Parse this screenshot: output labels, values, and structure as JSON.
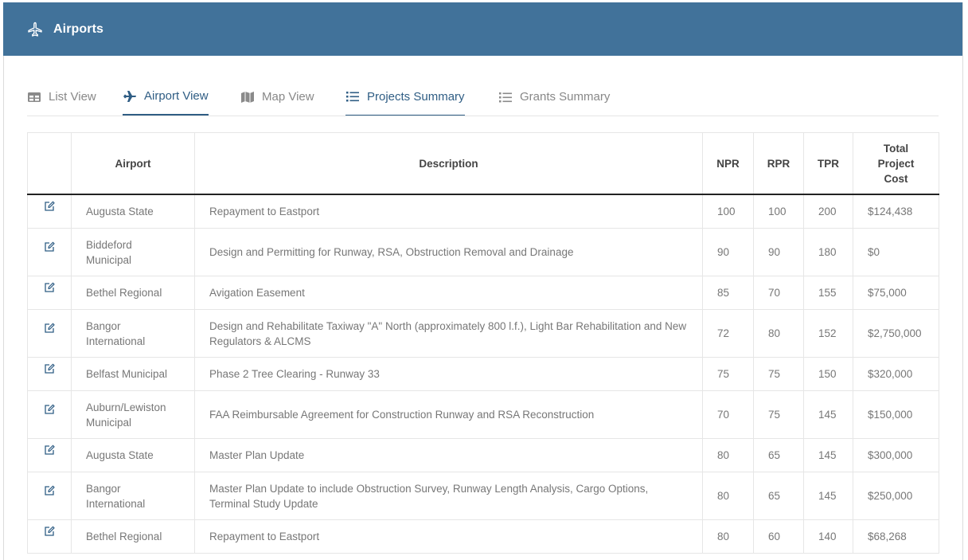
{
  "header": {
    "title": "Airports",
    "icon": "plane-icon"
  },
  "tabs": [
    {
      "label": "List View",
      "icon": "table-icon"
    },
    {
      "label": "Airport View",
      "icon": "plane-icon"
    },
    {
      "label": "Map View",
      "icon": "map-icon"
    },
    {
      "label": "Projects Summary",
      "icon": "list-icon"
    },
    {
      "label": "Grants Summary",
      "icon": "list-icon"
    }
  ],
  "table": {
    "headers": [
      "",
      "Airport",
      "Description",
      "NPR",
      "RPR",
      "TPR",
      "Total Project Cost"
    ],
    "rows": [
      {
        "airport": "Augusta State",
        "description": "Repayment to Eastport",
        "npr": "100",
        "rpr": "100",
        "tpr": "200",
        "cost": "$124,438"
      },
      {
        "airport": "Biddeford Municipal",
        "description": "Design and Permitting for Runway, RSA, Obstruction Removal and Drainage",
        "npr": "90",
        "rpr": "90",
        "tpr": "180",
        "cost": "$0"
      },
      {
        "airport": "Bethel Regional",
        "description": "Avigation Easement",
        "npr": "85",
        "rpr": "70",
        "tpr": "155",
        "cost": "$75,000"
      },
      {
        "airport": "Bangor International",
        "description": "Design and Rehabilitate Taxiway \"A\" North (approximately 800 l.f.), Light Bar Rehabilitation and New Regulators & ALCMS",
        "npr": "72",
        "rpr": "80",
        "tpr": "152",
        "cost": "$2,750,000"
      },
      {
        "airport": "Belfast Municipal",
        "description": "Phase 2 Tree Clearing - Runway 33",
        "npr": "75",
        "rpr": "75",
        "tpr": "150",
        "cost": "$320,000"
      },
      {
        "airport": "Auburn/Lewiston Municipal",
        "description": "FAA Reimbursable Agreement for Construction Runway and RSA Reconstruction",
        "npr": "70",
        "rpr": "75",
        "tpr": "145",
        "cost": "$150,000"
      },
      {
        "airport": "Augusta State",
        "description": "Master Plan Update",
        "npr": "80",
        "rpr": "65",
        "tpr": "145",
        "cost": "$300,000"
      },
      {
        "airport": "Bangor International",
        "description": "Master Plan Update to include Obstruction Survey, Runway Length Analysis, Cargo Options, Terminal Study Update",
        "npr": "80",
        "rpr": "65",
        "tpr": "145",
        "cost": "$250,000"
      },
      {
        "airport": "Bethel Regional",
        "description": "Repayment to Eastport",
        "npr": "80",
        "rpr": "60",
        "tpr": "140",
        "cost": "$68,268"
      }
    ]
  },
  "colors": {
    "header_bg": "#41729a",
    "active_tab": "#2f5d84"
  }
}
